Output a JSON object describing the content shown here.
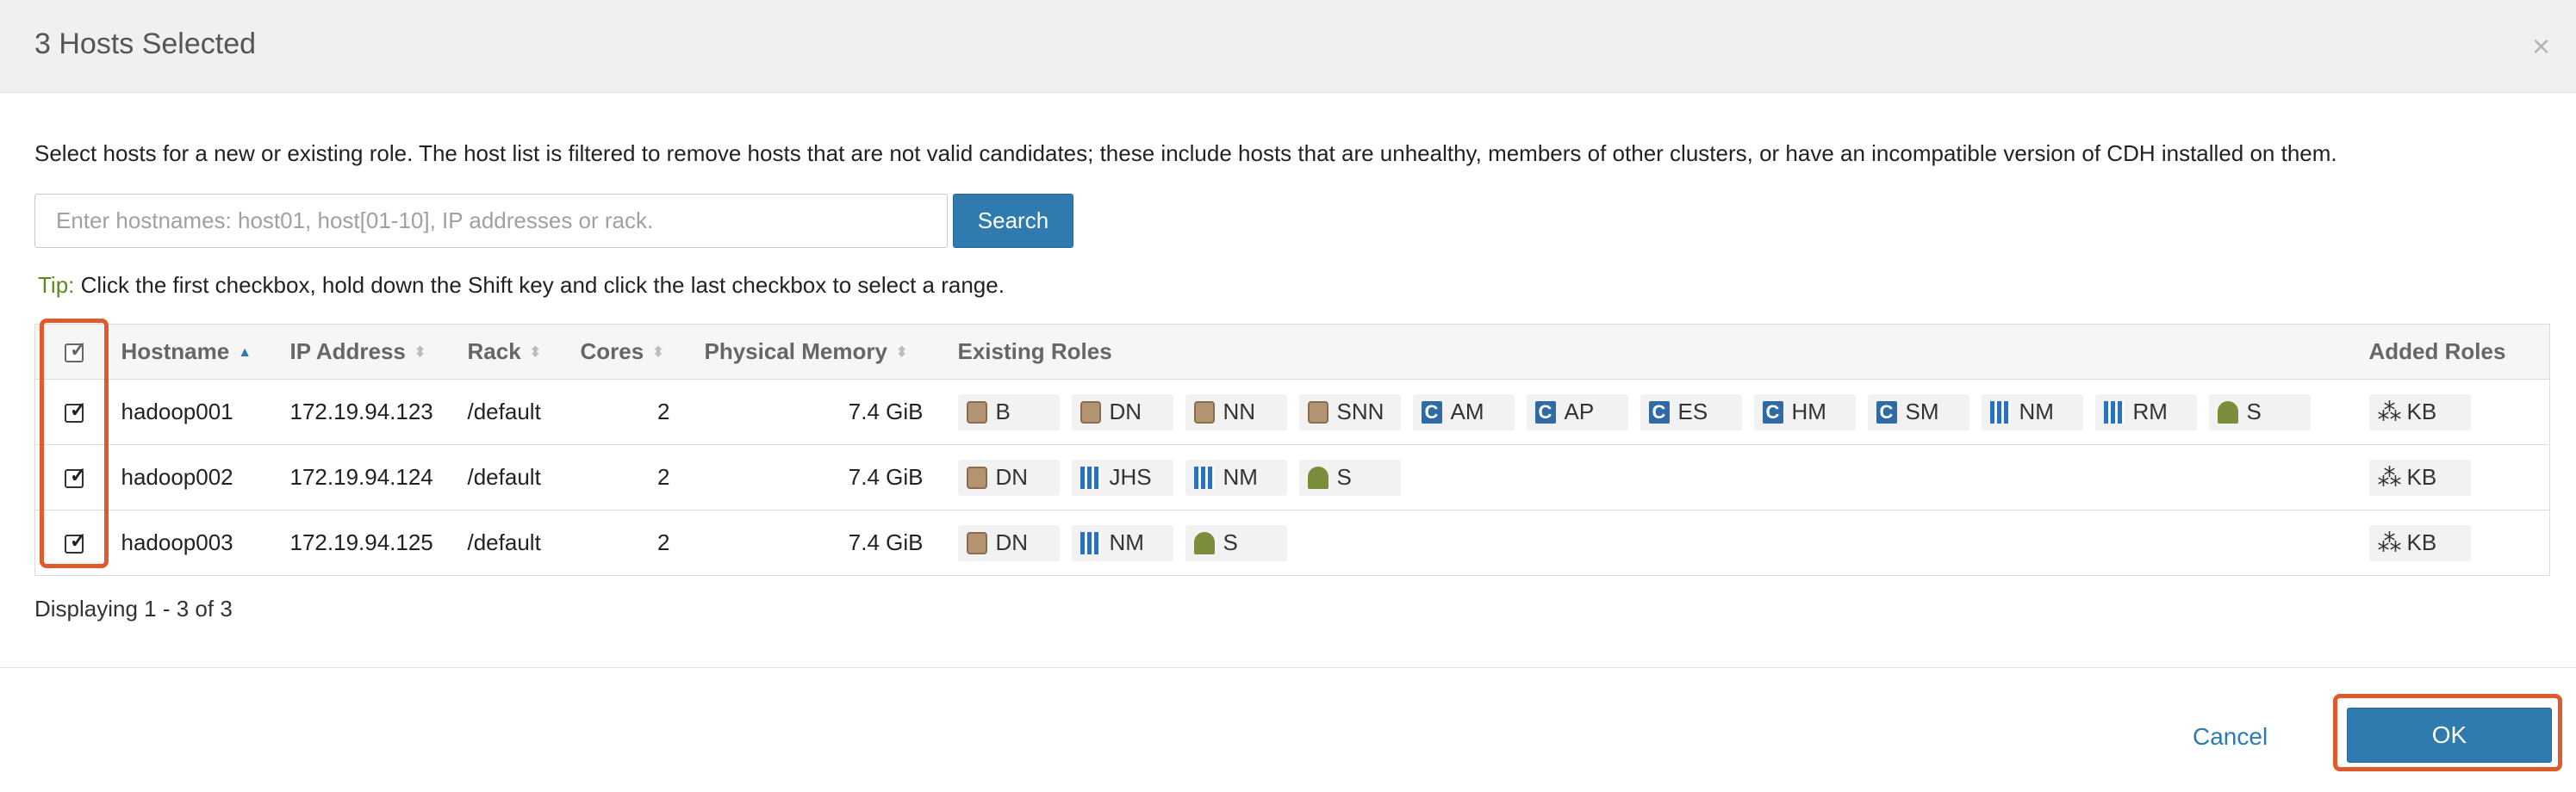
{
  "dialog": {
    "title": "3 Hosts Selected",
    "close_glyph": "×",
    "description": "Select hosts for a new or existing role. The host list is filtered to remove hosts that are not valid candidates; these include hosts that are unhealthy, members of other clusters, or have an incompatible version of CDH installed on them."
  },
  "search": {
    "placeholder": "Enter hostnames: host01, host[01-10], IP addresses or rack.",
    "value": "",
    "button_label": "Search"
  },
  "tip": {
    "label": "Tip:",
    "text": " Click the first checkbox, hold down the Shift key and click the last checkbox to select a range."
  },
  "table": {
    "columns": [
      "Hostname",
      "IP Address",
      "Rack",
      "Cores",
      "Physical Memory",
      "Existing Roles",
      "Added Roles"
    ],
    "sorted_column": "Hostname",
    "select_all_checked": true,
    "rows": [
      {
        "checked": true,
        "hostname": "hadoop001",
        "ip": "172.19.94.123",
        "rack": "/default",
        "cores": "2",
        "memory": "7.4 GiB",
        "existing_roles": [
          {
            "icon": "hdfs-icon",
            "label": "B"
          },
          {
            "icon": "hdfs-icon",
            "label": "DN"
          },
          {
            "icon": "hdfs-icon",
            "label": "NN"
          },
          {
            "icon": "hdfs-icon",
            "label": "SNN"
          },
          {
            "icon": "cloudera-icon",
            "label": "AM"
          },
          {
            "icon": "cloudera-icon",
            "label": "AP"
          },
          {
            "icon": "cloudera-icon",
            "label": "ES"
          },
          {
            "icon": "cloudera-icon",
            "label": "HM"
          },
          {
            "icon": "cloudera-icon",
            "label": "SM"
          },
          {
            "icon": "yarn-icon",
            "label": "NM"
          },
          {
            "icon": "yarn-icon",
            "label": "RM"
          },
          {
            "icon": "zookeeper-icon",
            "label": "S"
          }
        ],
        "added_roles": [
          {
            "icon": "kafka-icon",
            "label": "KB"
          }
        ]
      },
      {
        "checked": true,
        "hostname": "hadoop002",
        "ip": "172.19.94.124",
        "rack": "/default",
        "cores": "2",
        "memory": "7.4 GiB",
        "existing_roles": [
          {
            "icon": "hdfs-icon",
            "label": "DN"
          },
          {
            "icon": "yarn-icon",
            "label": "JHS"
          },
          {
            "icon": "yarn-icon",
            "label": "NM"
          },
          {
            "icon": "zookeeper-icon",
            "label": "S"
          }
        ],
        "added_roles": [
          {
            "icon": "kafka-icon",
            "label": "KB"
          }
        ]
      },
      {
        "checked": true,
        "hostname": "hadoop003",
        "ip": "172.19.94.125",
        "rack": "/default",
        "cores": "2",
        "memory": "7.4 GiB",
        "existing_roles": [
          {
            "icon": "hdfs-icon",
            "label": "DN"
          },
          {
            "icon": "yarn-icon",
            "label": "NM"
          },
          {
            "icon": "zookeeper-icon",
            "label": "S"
          }
        ],
        "added_roles": [
          {
            "icon": "kafka-icon",
            "label": "KB"
          }
        ]
      }
    ]
  },
  "pagination_text": "Displaying 1 - 3 of 3",
  "footer": {
    "cancel_label": "Cancel",
    "ok_label": "OK"
  },
  "colors": {
    "accent": "#2f7aaf",
    "highlight": "#e05a2b",
    "tip_label": "#5a8a1e"
  }
}
